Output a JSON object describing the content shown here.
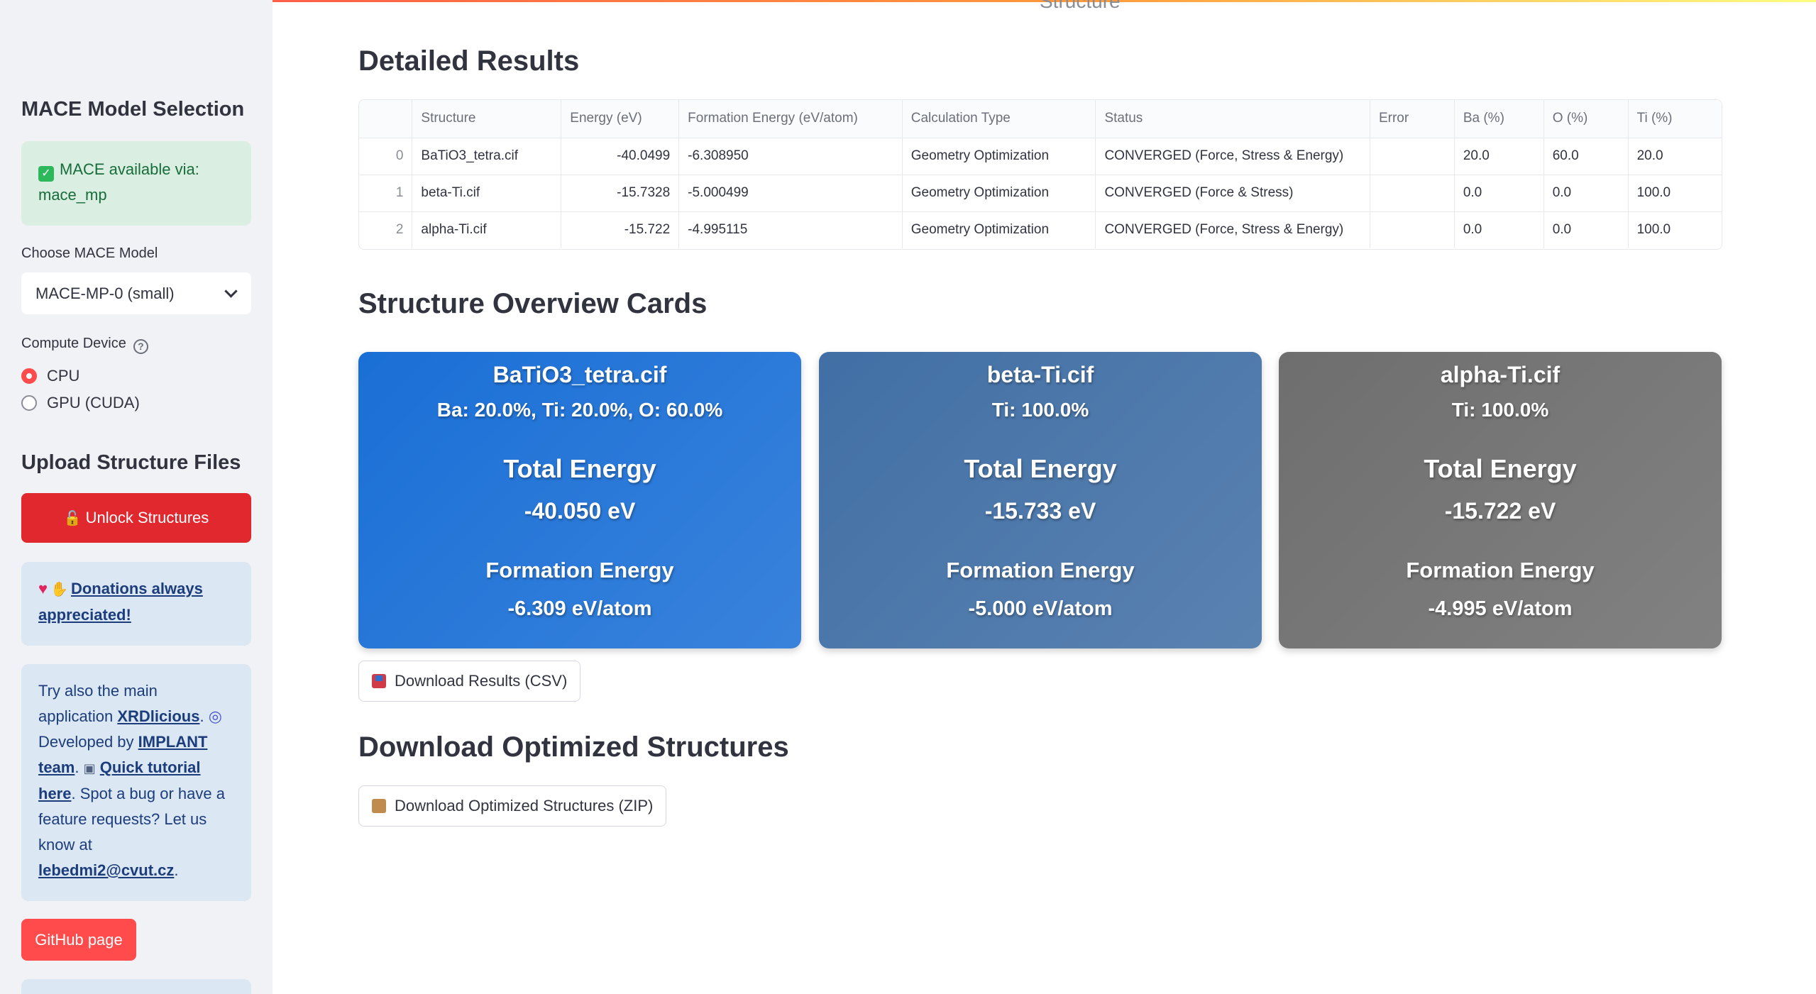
{
  "sidebar": {
    "model_heading": "MACE Model Selection",
    "success_text": "MACE available via: mace_mp",
    "choose_model_label": "Choose MACE Model",
    "selected_model": "MACE-MP-0 (small)",
    "device_label": "Compute Device",
    "device_options": [
      "CPU",
      "GPU (CUDA)"
    ],
    "device_selected": "CPU",
    "upload_heading": "Upload Structure Files",
    "unlock_button": "Unlock Structures",
    "donation_link": "Donations always appreciated!",
    "info": {
      "t1": "Try also the main application ",
      "link_xrd": "XRDlicious",
      "t2": ". ",
      "t3": " Developed by ",
      "link_team": "IMPLANT team",
      "t4": ". ",
      "link_tutorial": "Quick tutorial here",
      "t5": ". Spot a bug or have a feature requests? Let us know at ",
      "email": "lebedmi2@cvut.cz",
      "t6": "."
    },
    "github_button": "GitHub page"
  },
  "main": {
    "partial_title": "Structure",
    "results_title": "Detailed Results",
    "table": {
      "headers": [
        "",
        "Structure",
        "Energy (eV)",
        "Formation Energy (eV/atom)",
        "Calculation Type",
        "Status",
        "Error",
        "Ba (%)",
        "O (%)",
        "Ti (%)"
      ],
      "rows": [
        [
          "0",
          "BaTiO3_tetra.cif",
          "-40.0499",
          "-6.308950",
          "Geometry Optimization",
          "CONVERGED (Force, Stress & Energy)",
          "",
          "20.0",
          "60.0",
          "20.0"
        ],
        [
          "1",
          "beta-Ti.cif",
          "-15.7328",
          "-5.000499",
          "Geometry Optimization",
          "CONVERGED (Force & Stress)",
          "",
          "0.0",
          "0.0",
          "100.0"
        ],
        [
          "2",
          "alpha-Ti.cif",
          "-15.722",
          "-4.995115",
          "Geometry Optimization",
          "CONVERGED (Force, Stress & Energy)",
          "",
          "0.0",
          "0.0",
          "100.0"
        ]
      ]
    },
    "cards_title": "Structure Overview Cards",
    "cards": [
      {
        "name": "BaTiO3_tetra.cif",
        "composition": "Ba: 20.0%, Ti: 20.0%, O: 60.0%",
        "energy_label": "Total Energy",
        "energy": "-40.050 eV",
        "formation_label": "Formation Energy",
        "formation": "-6.309 eV/atom",
        "color": "#1a6fd6"
      },
      {
        "name": "beta-Ti.cif",
        "composition": "Ti: 100.0%",
        "energy_label": "Total Energy",
        "energy": "-15.733 eV",
        "formation_label": "Formation Energy",
        "formation": "-5.000 eV/atom",
        "color": "#416fa5"
      },
      {
        "name": "alpha-Ti.cif",
        "composition": "Ti: 100.0%",
        "energy_label": "Total Energy",
        "energy": "-15.722 eV",
        "formation_label": "Formation Energy",
        "formation": "-4.995 eV/atom",
        "color": "#6e6e6e"
      }
    ],
    "download_csv": "Download Results (CSV)",
    "optimized_title": "Download Optimized Structures",
    "download_zip": "Download Optimized Structures (ZIP)"
  },
  "colors": {
    "accent": "#ff4b4b",
    "sidebar_bg": "#f0f2f6",
    "success_bg": "#dbeee2",
    "info_bg": "#dce7f4",
    "unlock_button": "#e0282e"
  }
}
